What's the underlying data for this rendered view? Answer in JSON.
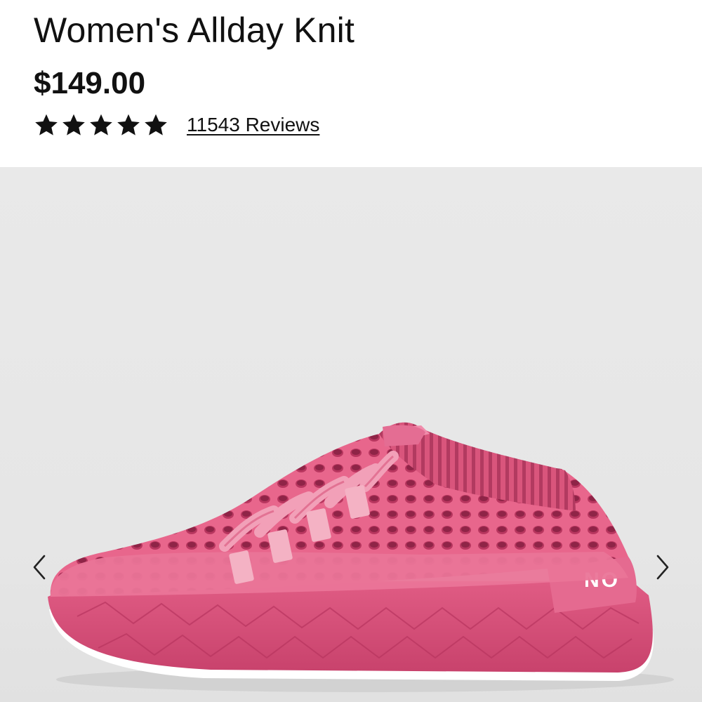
{
  "product": {
    "title": "Women's Allday Knit",
    "price": "$149.00",
    "rating": 5,
    "rating_max": 5,
    "reviews_label": "11543 Reviews",
    "star_icon": "star-icon"
  },
  "gallery": {
    "image_name": "pink-knit-sneaker",
    "prev_icon": "chevron-left-icon",
    "next_icon": "chevron-right-icon",
    "heel_logo_text": "NO",
    "colors": {
      "background": "#e7e7e7",
      "upper": "#ea6f93",
      "sole": "#d84f79",
      "outsole": "#ffffff"
    }
  }
}
